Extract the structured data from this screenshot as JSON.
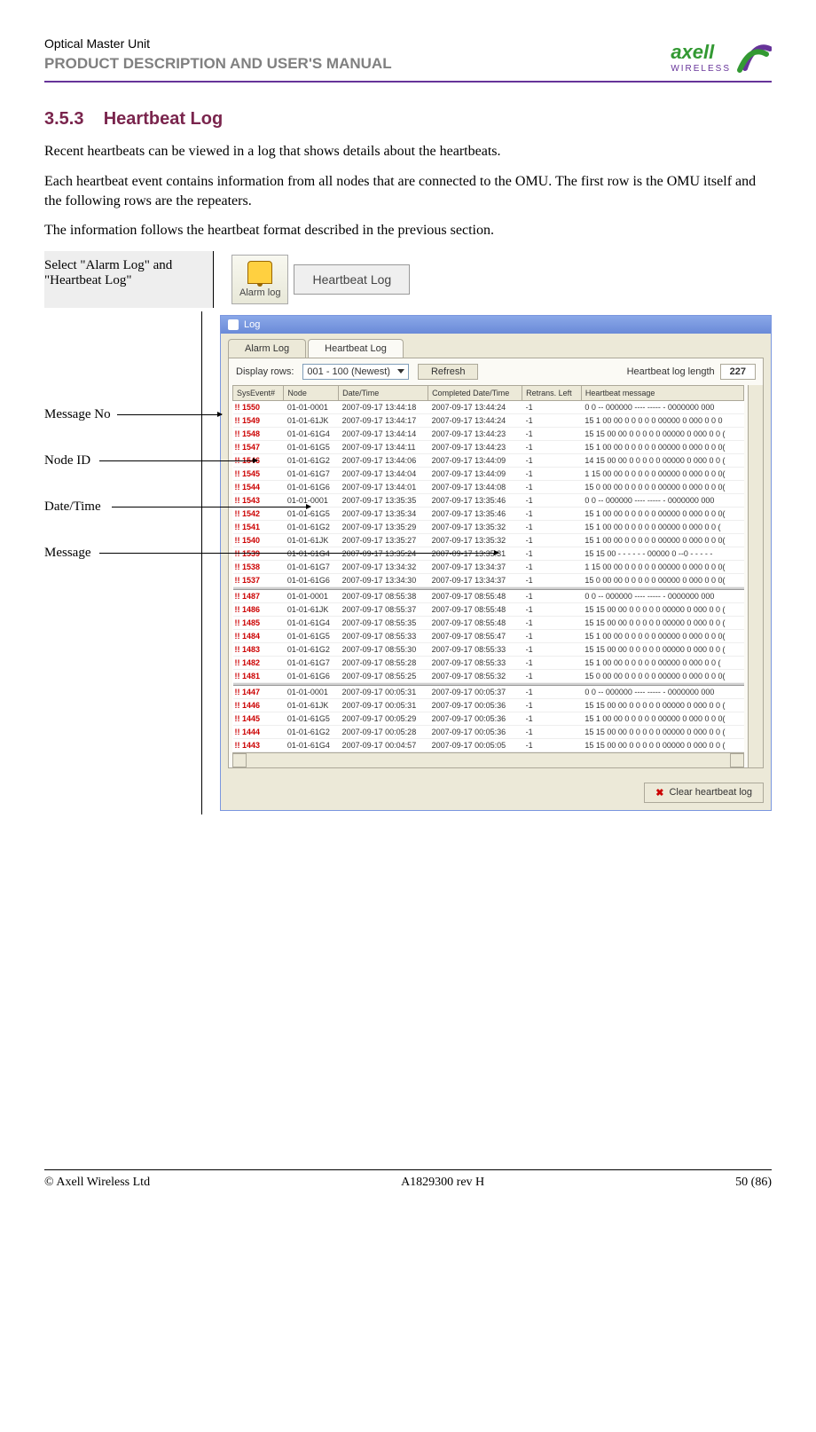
{
  "header": {
    "doc_title": "Optical Master Unit",
    "doc_subtitle": "PRODUCT DESCRIPTION AND USER'S MANUAL",
    "logo_main": "axell",
    "logo_sub": "WIRELESS"
  },
  "section": {
    "number": "3.5.3",
    "title": "Heartbeat Log",
    "para1": "Recent heartbeats can be viewed in a log that shows details about the heartbeats.",
    "para2": "Each heartbeat event contains information from all nodes that are connected to the OMU. The first row is the OMU itself and the following rows are the repeaters.",
    "para3": "The information follows the heartbeat format described in the previous section."
  },
  "select_hint": "Select \"Alarm Log\" and \"Heartbeat Log\"",
  "alarm_btn_label": "Alarm log",
  "hb_btn_label": "Heartbeat Log",
  "annotations": {
    "msgno": "Message No",
    "nodeid": "Node ID",
    "datetime": "Date/Time",
    "message": "Message"
  },
  "logwin": {
    "title": "Log",
    "tab1": "Alarm Log",
    "tab2": "Heartbeat Log",
    "display_rows_label": "Display rows:",
    "display_rows_value": "001 - 100  (Newest)",
    "refresh": "Refresh",
    "hb_len_label": "Heartbeat log length",
    "hb_len_value": "227",
    "columns": [
      "SysEvent#",
      "Node",
      "Date/Time",
      "Completed Date/Time",
      "Retrans. Left",
      "Heartbeat message"
    ],
    "rows": [
      {
        "ev": "1550",
        "node": "01-01-0001",
        "dt": "2007-09-17  13:44:18",
        "cdt": "2007-09-17  13:44:24",
        "rl": "-1",
        "msg": "0 0 -- 000000 ---- ----- - 0000000 000"
      },
      {
        "ev": "1549",
        "node": "01-01-61JK",
        "dt": "2007-09-17  13:44:17",
        "cdt": "2007-09-17  13:44:24",
        "rl": "-1",
        "msg": "15 1 00 00 0 0 0 0 0 00000 0 000 0 0 0"
      },
      {
        "ev": "1548",
        "node": "01-01-61G4",
        "dt": "2007-09-17  13:44:14",
        "cdt": "2007-09-17  13:44:23",
        "rl": "-1",
        "msg": "15 15 00 00 0 0 0 0 0 00000 0 000 0 0 ("
      },
      {
        "ev": "1547",
        "node": "01-01-61G5",
        "dt": "2007-09-17  13:44:11",
        "cdt": "2007-09-17  13:44:23",
        "rl": "-1",
        "msg": "15 1 00 00 0 0 0 0 0 00000 0 000 0 0 0("
      },
      {
        "ev": "1546",
        "node": "01-01-61G2",
        "dt": "2007-09-17  13:44:06",
        "cdt": "2007-09-17  13:44:09",
        "rl": "-1",
        "msg": "14 15 00 00 0 0 0 0 0 00000 0 000 0 0 ("
      },
      {
        "ev": "1545",
        "node": "01-01-61G7",
        "dt": "2007-09-17  13:44:04",
        "cdt": "2007-09-17  13:44:09",
        "rl": "-1",
        "msg": "1 15 00 00 0 0 0 0 0 00000 0 000 0 0 0("
      },
      {
        "ev": "1544",
        "node": "01-01-61G6",
        "dt": "2007-09-17  13:44:01",
        "cdt": "2007-09-17  13:44:08",
        "rl": "-1",
        "msg": "15 0 00 00 0 0 0 0 0 00000 0 000 0 0 0("
      },
      {
        "ev": "1543",
        "node": "01-01-0001",
        "dt": "2007-09-17  13:35:35",
        "cdt": "2007-09-17  13:35:46",
        "rl": "-1",
        "msg": "0 0 -- 000000 ---- ----- - 0000000 000"
      },
      {
        "ev": "1542",
        "node": "01-01-61G5",
        "dt": "2007-09-17  13:35:34",
        "cdt": "2007-09-17  13:35:46",
        "rl": "-1",
        "msg": "15 1 00 00 0 0 0 0 0 00000 0 000 0 0 0("
      },
      {
        "ev": "1541",
        "node": "01-01-61G2",
        "dt": "2007-09-17  13:35:29",
        "cdt": "2007-09-17  13:35:32",
        "rl": "-1",
        "msg": "15 1 00 00 0 0 0 0 0 00000 0 000 0 0 ("
      },
      {
        "ev": "1540",
        "node": "01-01-61JK",
        "dt": "2007-09-17  13:35:27",
        "cdt": "2007-09-17  13:35:32",
        "rl": "-1",
        "msg": "15 1 00 00 0 0 0 0 0 00000 0 000 0 0 0("
      },
      {
        "ev": "1539",
        "node": "01-01-61G4",
        "dt": "2007-09-17  13:35:24",
        "cdt": "2007-09-17  13:35:31",
        "rl": "-1",
        "msg": "15 15 00 - - - - - - 00000 0 --0 - - - - -"
      },
      {
        "ev": "1538",
        "node": "01-01-61G7",
        "dt": "2007-09-17  13:34:32",
        "cdt": "2007-09-17  13:34:37",
        "rl": "-1",
        "msg": "1 15 00 00 0 0 0 0 0 00000 0 000 0 0 0("
      },
      {
        "ev": "1537",
        "node": "01-01-61G6",
        "dt": "2007-09-17  13:34:30",
        "cdt": "2007-09-17  13:34:37",
        "rl": "-1",
        "msg": "15 0 00 00 0 0 0 0 0 00000 0 000 0 0 0("
      },
      {
        "ev": "1487",
        "node": "01-01-0001",
        "dt": "2007-09-17  08:55:38",
        "cdt": "2007-09-17  08:55:48",
        "rl": "-1",
        "msg": "0 0 -- 000000 ---- ----- - 0000000 000"
      },
      {
        "ev": "1486",
        "node": "01-01-61JK",
        "dt": "2007-09-17  08:55:37",
        "cdt": "2007-09-17  08:55:48",
        "rl": "-1",
        "msg": "15 15 00 00 0 0 0 0 0 00000 0 000 0 0 ("
      },
      {
        "ev": "1485",
        "node": "01-01-61G4",
        "dt": "2007-09-17  08:55:35",
        "cdt": "2007-09-17  08:55:48",
        "rl": "-1",
        "msg": "15 15 00 00 0 0 0 0 0 00000 0 000 0 0 ("
      },
      {
        "ev": "1484",
        "node": "01-01-61G5",
        "dt": "2007-09-17  08:55:33",
        "cdt": "2007-09-17  08:55:47",
        "rl": "-1",
        "msg": "15 1 00 00 0 0 0 0 0 00000 0 000 0 0 0("
      },
      {
        "ev": "1483",
        "node": "01-01-61G2",
        "dt": "2007-09-17  08:55:30",
        "cdt": "2007-09-17  08:55:33",
        "rl": "-1",
        "msg": "15 15 00 00 0 0 0 0 0 00000 0 000 0 0 ("
      },
      {
        "ev": "1482",
        "node": "01-01-61G7",
        "dt": "2007-09-17  08:55:28",
        "cdt": "2007-09-17  08:55:33",
        "rl": "-1",
        "msg": "15 1 00 00 0 0 0 0 0 00000 0 000 0 0 ("
      },
      {
        "ev": "1481",
        "node": "01-01-61G6",
        "dt": "2007-09-17  08:55:25",
        "cdt": "2007-09-17  08:55:32",
        "rl": "-1",
        "msg": "15 0 00 00 0 0 0 0 0 00000 0 000 0 0 0("
      },
      {
        "ev": "1447",
        "node": "01-01-0001",
        "dt": "2007-09-17  00:05:31",
        "cdt": "2007-09-17  00:05:37",
        "rl": "-1",
        "msg": "0 0 -- 000000 ---- ----- - 0000000 000"
      },
      {
        "ev": "1446",
        "node": "01-01-61JK",
        "dt": "2007-09-17  00:05:31",
        "cdt": "2007-09-17  00:05:36",
        "rl": "-1",
        "msg": "15 15 00 00 0 0 0 0 0 00000 0 000 0 0 ("
      },
      {
        "ev": "1445",
        "node": "01-01-61G5",
        "dt": "2007-09-17  00:05:29",
        "cdt": "2007-09-17  00:05:36",
        "rl": "-1",
        "msg": "15 1 00 00 0 0 0 0 0 00000 0 000 0 0 0("
      },
      {
        "ev": "1444",
        "node": "01-01-61G2",
        "dt": "2007-09-17  00:05:28",
        "cdt": "2007-09-17  00:05:36",
        "rl": "-1",
        "msg": "15 15 00 00 0 0 0 0 0 00000 0 000 0 0 ("
      },
      {
        "ev": "1443",
        "node": "01-01-61G4",
        "dt": "2007-09-17  00:04:57",
        "cdt": "2007-09-17  00:05:05",
        "rl": "-1",
        "msg": "15 15 00 00 0 0 0 0 0 00000 0 000 0 0 ("
      }
    ],
    "clear_label": "Clear heartbeat log"
  },
  "footer": {
    "left": "© Axell Wireless Ltd",
    "center": "A1829300 rev H",
    "right": "50 (86)"
  }
}
